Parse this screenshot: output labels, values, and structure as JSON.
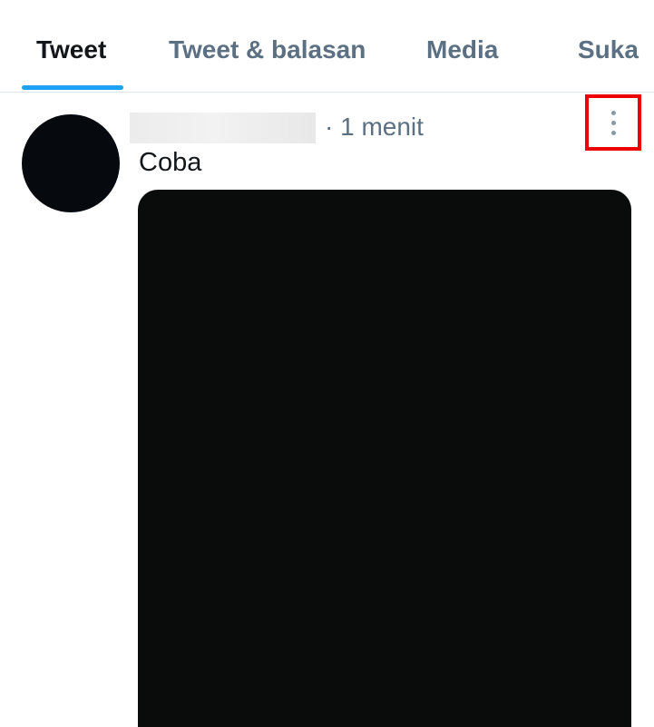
{
  "tabs": [
    {
      "label": "Tweet",
      "active": true
    },
    {
      "label": "Tweet & balasan",
      "active": false
    },
    {
      "label": "Media",
      "active": false
    },
    {
      "label": "Suka",
      "active": false
    }
  ],
  "tweet": {
    "time": "· 1 menit",
    "text": "Coba",
    "more_icon": "more-vertical-icon"
  },
  "colors": {
    "accent": "#1da1f2",
    "highlight_box": "#ee0000",
    "secondary_text": "#5b7083",
    "primary_text": "#14171a"
  }
}
